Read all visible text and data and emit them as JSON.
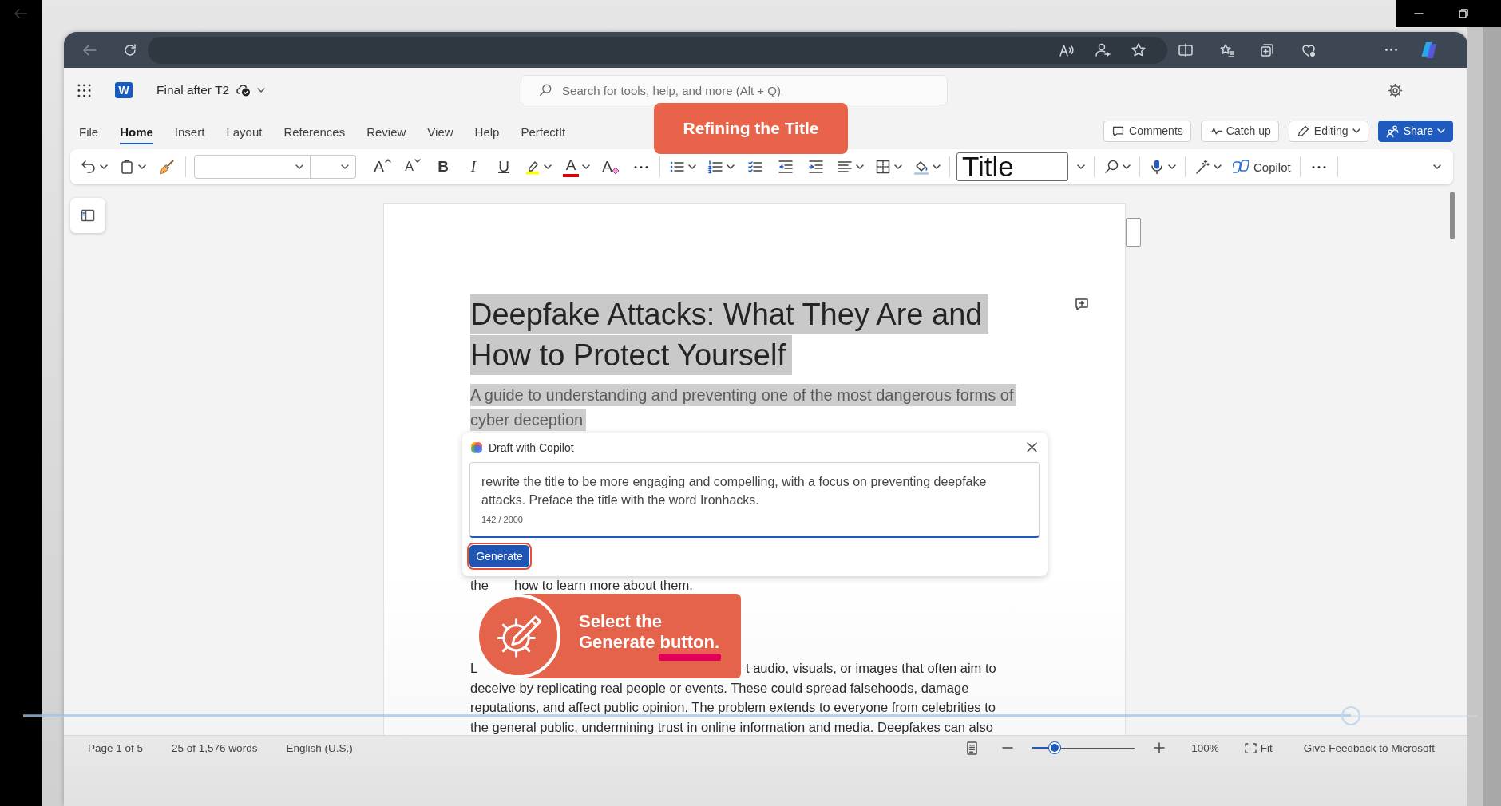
{
  "video": {
    "progress": {
      "level": 0.913
    }
  },
  "app": {
    "logo_letter": "W",
    "document_name": "Final after T2",
    "search": {
      "placeholder": "Search for tools, help, and more (Alt + Q)"
    },
    "tabs": [
      {
        "label": "File",
        "selected": false
      },
      {
        "label": "Home",
        "selected": true
      },
      {
        "label": "Insert",
        "selected": false
      },
      {
        "label": "Layout",
        "selected": false
      },
      {
        "label": "References",
        "selected": false
      },
      {
        "label": "Review",
        "selected": false
      },
      {
        "label": "View",
        "selected": false
      },
      {
        "label": "Help",
        "selected": false
      },
      {
        "label": "PerfectIt",
        "selected": false
      }
    ],
    "actions": [
      {
        "kind": "comments",
        "label": "Comments"
      },
      {
        "kind": "catch_up",
        "label": "Catch up"
      },
      {
        "kind": "editing",
        "label": "Editing"
      },
      {
        "kind": "share",
        "label": "Share"
      }
    ]
  },
  "ribbon": {
    "font_buttons": [
      {
        "kind": "grow",
        "glyph": "A"
      },
      {
        "kind": "shrink",
        "glyph": "A"
      },
      {
        "kind": "bold",
        "glyph": "B"
      },
      {
        "kind": "italic",
        "glyph": "I"
      },
      {
        "kind": "underline",
        "glyph": "U"
      }
    ],
    "highlight": {
      "color": "#ffff00"
    },
    "font_color": {
      "glyph": "A",
      "color": "#e00000"
    },
    "clear_formatting": {
      "glyph": "A"
    },
    "style": "Title",
    "copilot": "Copilot"
  },
  "banner": {
    "text": "Refining the Title"
  },
  "document": {
    "title": "Deepfake Attacks: What They Are and How to Protect Yourself",
    "subtitle": "A guide to understanding and preventing one of the most dangerous forms of cyber deception",
    "selected": true,
    "lines": [
      {
        "segments": [
          "the",
          "how to learn more about them."
        ]
      },
      {
        "segments": [
          "L",
          "t audio, visuals, or images that often aim to"
        ]
      },
      {
        "segments": [
          "deceive by replicating real people or events. These could spread falsehoods, damage"
        ]
      },
      {
        "segments": [
          "reputations, and affect public opinion. The problem extends to everyone from celebrities to"
        ]
      },
      {
        "segments": [
          "the general public, undermining trust in online information and media. Deepfakes can also"
        ]
      }
    ]
  },
  "copilot": {
    "title": "Draft with Copilot",
    "prompt": "rewrite the title to be more engaging and compelling, with a focus on preventing deepfake attacks. Preface the title with the word Ironhacks.",
    "counter": "142 / 2000",
    "button": "Generate"
  },
  "hint": {
    "text": "Select the Generate button."
  },
  "status_bar": {
    "items": [
      "Page 1 of 5",
      "25 of 1,576 words",
      "English (U.S.)"
    ],
    "zoom": {
      "level": 0.22
    },
    "zoom_reading": "100%",
    "fit": "Fit",
    "feedback": "Give Feedback to Microsoft"
  }
}
